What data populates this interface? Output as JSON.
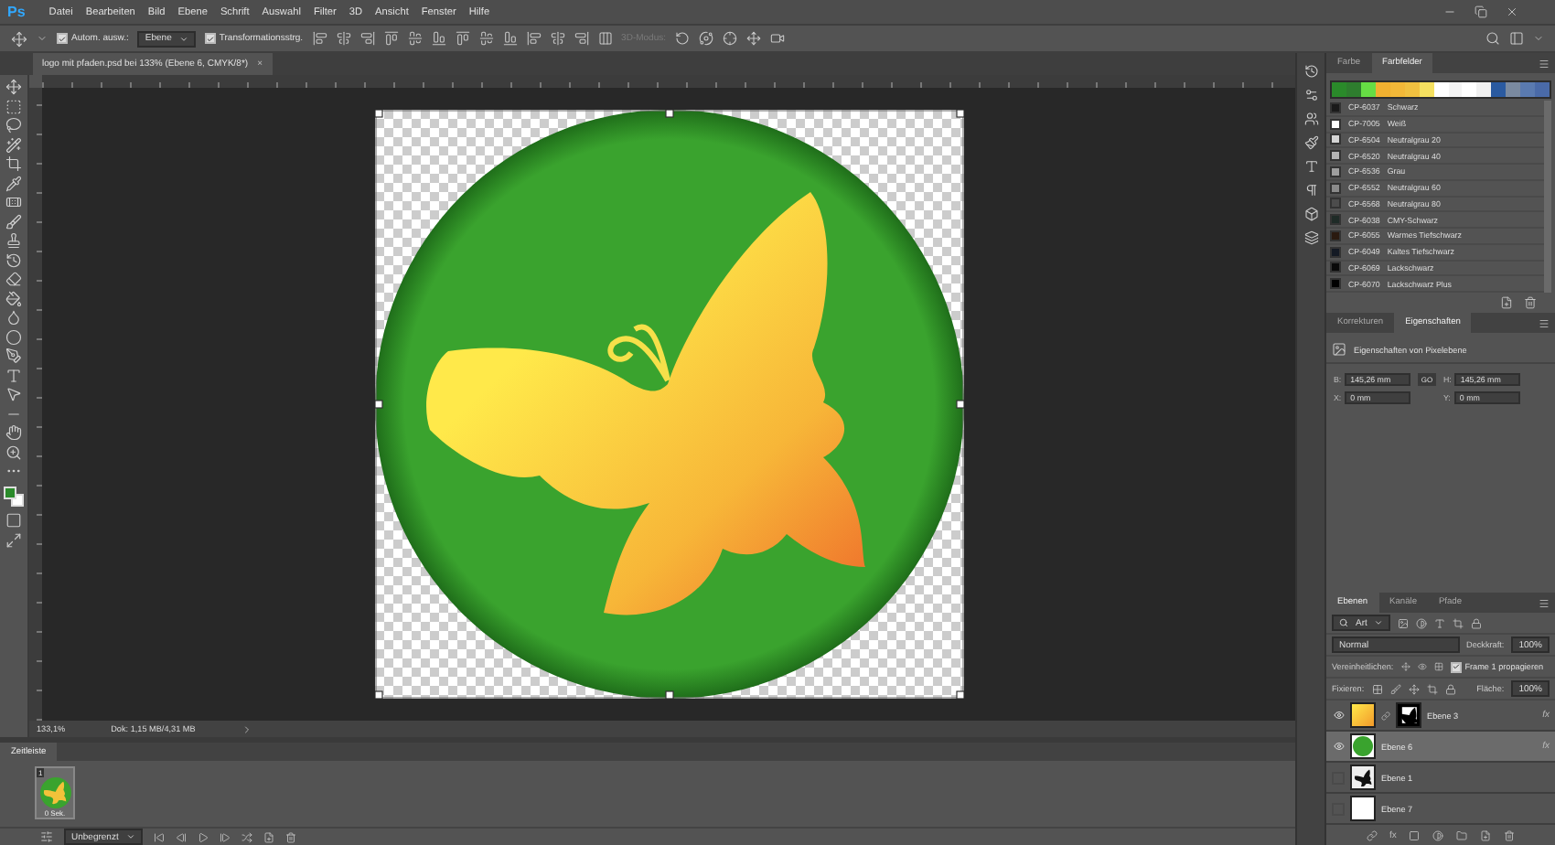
{
  "app": {
    "logo": "Ps"
  },
  "menu": [
    "Datei",
    "Bearbeiten",
    "Bild",
    "Ebene",
    "Schrift",
    "Auswahl",
    "Filter",
    "3D",
    "Ansicht",
    "Fenster",
    "Hilfe"
  ],
  "options_bar": {
    "auto_select": {
      "label": "Autom. ausw.:",
      "checked": true
    },
    "auto_select_target": "Ebene",
    "transform_controls": {
      "label": "Transformationsstrg.",
      "checked": true
    },
    "mode_3d": "3D-Modus:"
  },
  "document_tab": {
    "title": "logo mit pfaden.psd bei 133% (Ebene 6, CMYK/8*)",
    "close": "×"
  },
  "status_bar": {
    "zoom": "133,1%",
    "document_size": "Dok: 1,15 MB/4,31 MB"
  },
  "timeline": {
    "tab": "Zeitleiste",
    "frame": {
      "number": "1",
      "duration": "0 Sek."
    },
    "loop": "Unbegrenzt"
  },
  "swatches_panel": {
    "tabs": [
      {
        "label": "Farbe",
        "selected": false
      },
      {
        "label": "Farbfelder",
        "selected": true
      }
    ],
    "recent_colors": [
      {
        "color": "#2a8a2a"
      },
      {
        "color": "#2e7d2e"
      },
      {
        "color": "#66dd44"
      },
      {
        "color": "#f0b030"
      },
      {
        "color": "#f2b838"
      },
      {
        "color": "#f0c040"
      },
      {
        "color": "#f5e060"
      },
      {
        "color": "#ffffff"
      },
      {
        "color": "#f4f4f4"
      },
      {
        "color": "#ffffff"
      },
      {
        "color": "#f0f0f0"
      },
      {
        "color": "#2a5aa0"
      },
      {
        "color": "#7a8aa0"
      },
      {
        "color": "#5a7ab0"
      },
      {
        "color": "#4a6aa8"
      }
    ],
    "swatches": [
      {
        "code": "CP-6037",
        "name": "Schwarz",
        "color": "#1a1a1a"
      },
      {
        "code": "CP-7005",
        "name": "Weiß",
        "color": "#ffffff"
      },
      {
        "code": "CP-6504",
        "name": "Neutralgrau 20",
        "color": "#d4d4d4"
      },
      {
        "code": "CP-6520",
        "name": "Neutralgrau 40",
        "color": "#b4b4b4"
      },
      {
        "code": "CP-6536",
        "name": "Grau",
        "color": "#9e9e9e"
      },
      {
        "code": "CP-6552",
        "name": "Neutralgrau 60",
        "color": "#8a8a8a"
      },
      {
        "code": "CP-6568",
        "name": "Neutralgrau 80",
        "color": "#4c4c4c"
      },
      {
        "code": "CP-6038",
        "name": "CMY-Schwarz",
        "color": "#1f2b27"
      },
      {
        "code": "CP-6055",
        "name": "Warmes Tiefschwarz",
        "color": "#2a1a10"
      },
      {
        "code": "CP-6049",
        "name": "Kaltes Tiefschwarz",
        "color": "#141a24"
      },
      {
        "code": "CP-6069",
        "name": "Lackschwarz",
        "color": "#0a0a0a"
      },
      {
        "code": "CP-6070",
        "name": "Lackschwarz Plus",
        "color": "#000000"
      }
    ]
  },
  "properties_panel": {
    "tabs": [
      {
        "label": "Korrekturen",
        "selected": false
      },
      {
        "label": "Eigenschaften",
        "selected": true
      }
    ],
    "heading": "Eigenschaften von Pixelebene",
    "fields": [
      {
        "label": "B:",
        "value": "145,26 mm"
      },
      {
        "label": "H:",
        "value": "145,26 mm"
      },
      {
        "label": "X:",
        "value": "0 mm"
      },
      {
        "label": "Y:",
        "value": "0 mm"
      }
    ],
    "link": "GO"
  },
  "layers_panel": {
    "tabs": [
      {
        "label": "Ebenen",
        "selected": true
      },
      {
        "label": "Kanäle",
        "selected": false
      },
      {
        "label": "Pfade",
        "selected": false
      }
    ],
    "filter": "Art",
    "blend_mode": "Normal",
    "opacity_label": "Deckkraft:",
    "opacity": "100%",
    "unify_label": "Vereinheitlichen:",
    "propagate": {
      "label": "Frame 1 propagieren",
      "checked": true
    },
    "lock_label": "Fixieren:",
    "fill_label": "Fläche:",
    "fill": "100%",
    "layers": [
      {
        "name": "Ebene 3",
        "kind": "gradient",
        "mask": true,
        "visible": true,
        "selected": false,
        "effects": "fx"
      },
      {
        "name": "Ebene 6",
        "kind": "circle",
        "mask": false,
        "visible": true,
        "selected": true,
        "effects": "fx"
      },
      {
        "name": "Ebene 1",
        "kind": "butterfly",
        "mask": false,
        "visible": false,
        "selected": false
      },
      {
        "name": "Ebene 7",
        "kind": "white",
        "mask": false,
        "visible": false,
        "selected": false
      }
    ],
    "footer_fx": "fx"
  }
}
